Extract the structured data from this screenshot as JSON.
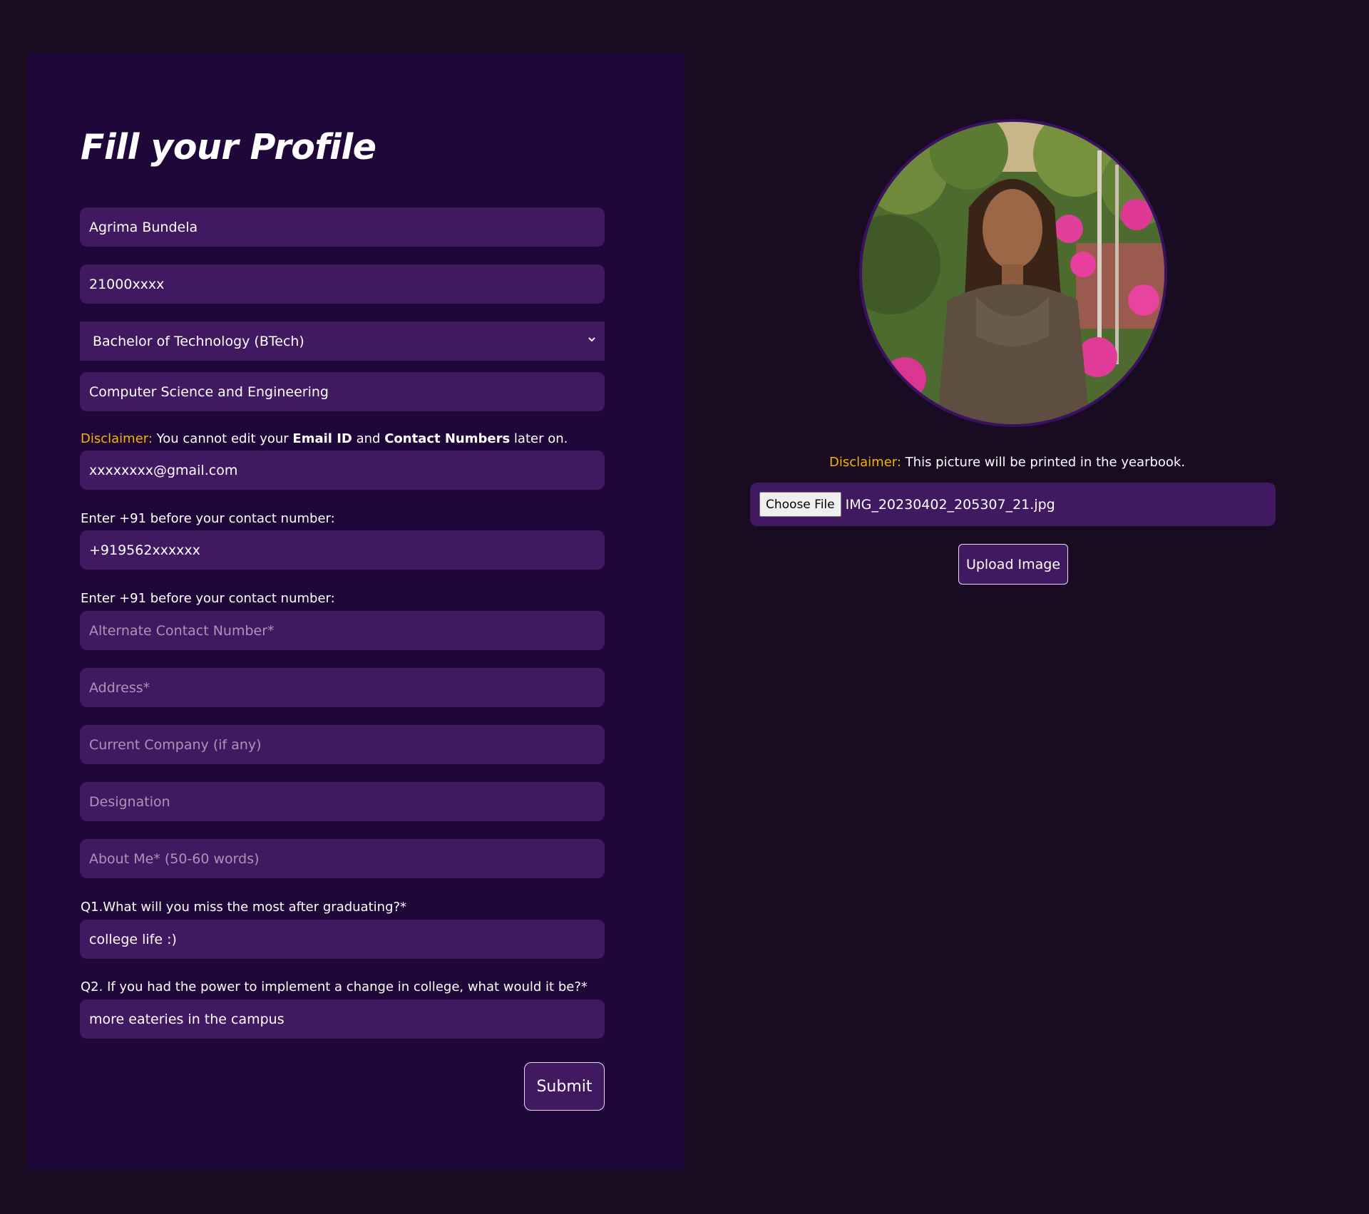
{
  "form": {
    "title": "Fill your Profile",
    "name_value": "Agrima Bundela",
    "roll_value": "21000xxxx",
    "degree_selected": "Bachelor of Technology (BTech)",
    "branch_value": "Computer Science and Engineering",
    "disclaimer": {
      "prefix": "Disclaimer:",
      "text_1": " You cannot edit your ",
      "bold_1": "Email ID",
      "text_2": " and ",
      "bold_2": "Contact Numbers",
      "text_3": " later on."
    },
    "email_value": "xxxxxxxx@gmail.com",
    "contact_hint": "Enter +91 before your contact number:",
    "contact_value": "+919562xxxxxx",
    "alt_contact_hint": "Enter +91 before your contact number:",
    "alt_contact_placeholder": "Alternate Contact Number*",
    "address_placeholder": "Address*",
    "company_placeholder": "Current Company (if any)",
    "designation_placeholder": "Designation",
    "about_placeholder": "About Me* (50-60 words)",
    "q1_label": "Q1.What will you miss the most after graduating?*",
    "q1_value": "college life :)",
    "q2_label": "Q2. If you had the power to implement a change in college, what would it be?*",
    "q2_value": "more eateries in the campus",
    "submit_label": "Submit"
  },
  "photo": {
    "disclaimer_prefix": "Disclaimer:",
    "disclaimer_text": " This picture will be printed in the yearbook.",
    "choose_file_label": "Choose File",
    "file_name": "IMG_20230402_205307_21.jpg",
    "upload_label": "Upload Image"
  },
  "colors": {
    "page_bg": "#190b21",
    "panel_bg": "#20073a",
    "field_bg": "#401960",
    "warning": "#f4b400"
  },
  "icons": {
    "select_arrow": "chevron-down-icon"
  }
}
